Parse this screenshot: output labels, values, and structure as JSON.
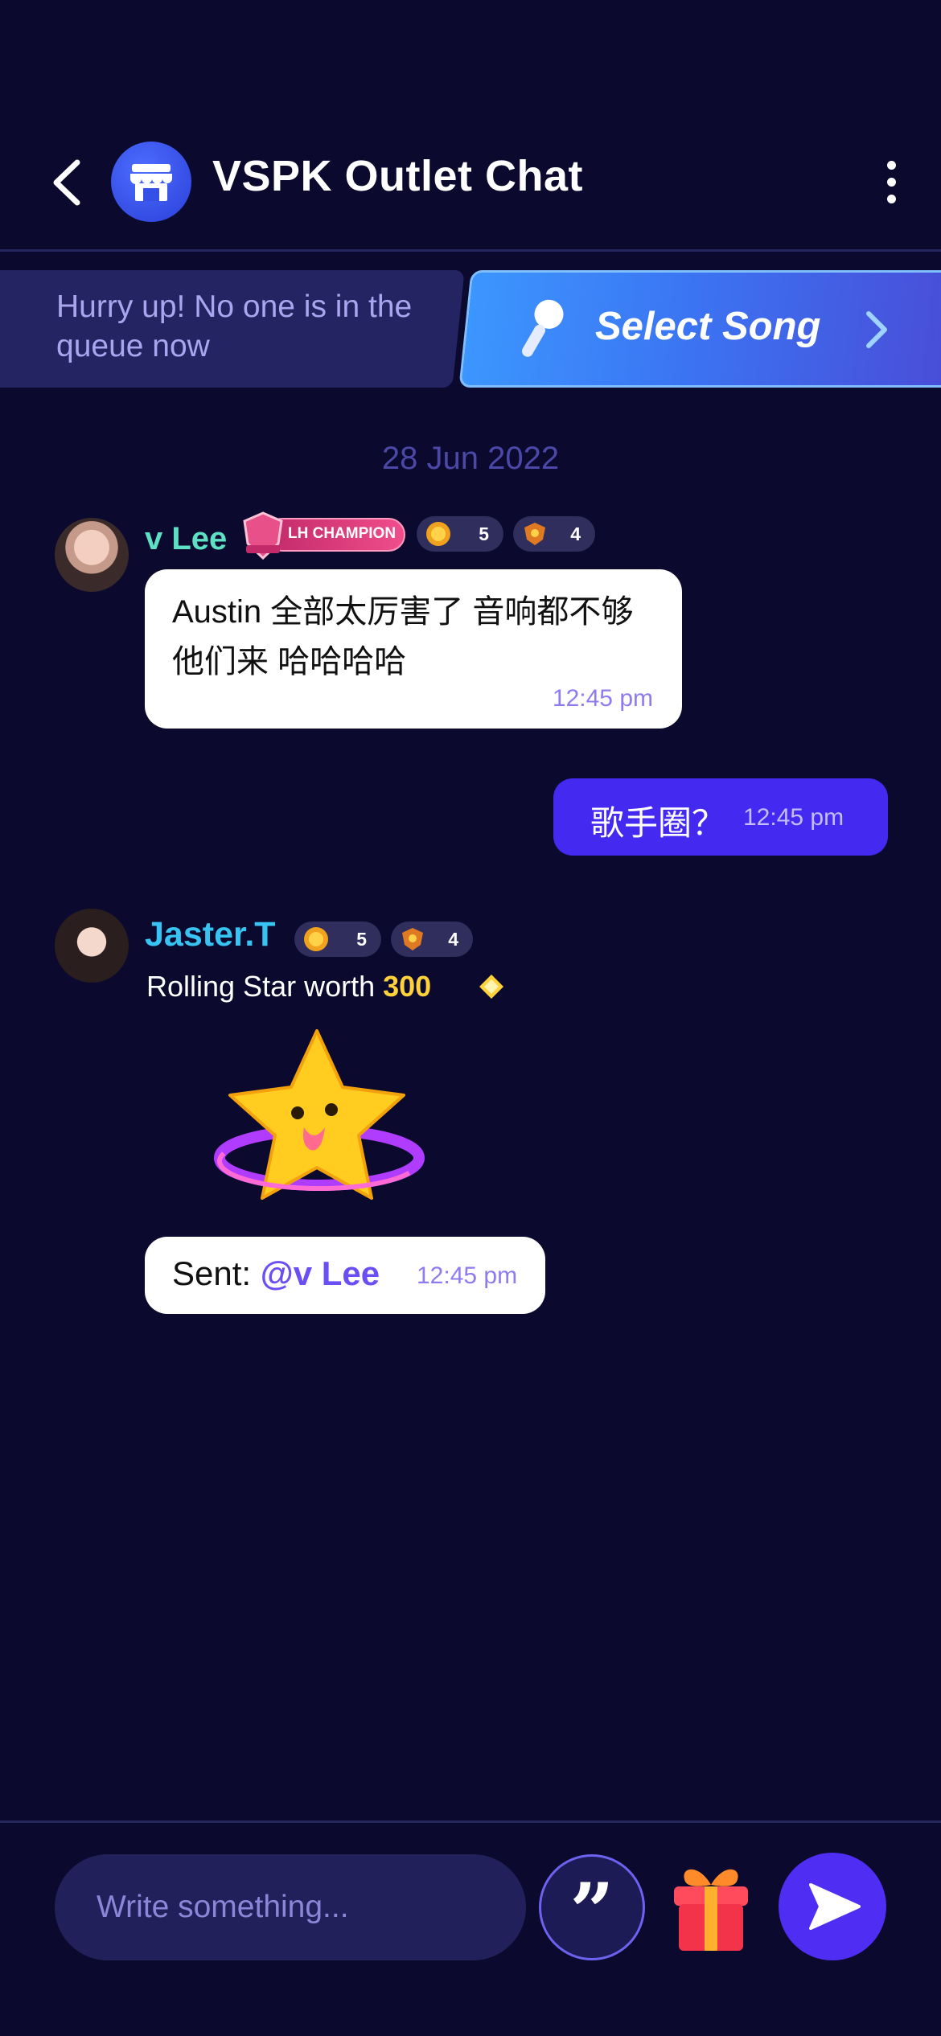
{
  "header": {
    "title": "VSPK Outlet Chat"
  },
  "queue": {
    "message": "Hurry up! No one is in the queue now",
    "select_song_label": "Select Song"
  },
  "date_separator": "28 Jun 2022",
  "messages": [
    {
      "user": "v Lee",
      "champion_badge": "LH CHAMPION",
      "badges": [
        "5",
        "4"
      ],
      "text": "Austin 全部太厉害了 音响都不够他们来 哈哈哈哈",
      "time": "12:45 pm"
    },
    {
      "self": true,
      "text": "歌手圈？",
      "time": "12:45 pm"
    },
    {
      "user": "Jaster.T",
      "badges": [
        "5",
        "4"
      ],
      "gift_prefix": "Rolling Star worth",
      "gift_amount": "300",
      "sent_prefix": "Sent:",
      "mention": "@v Lee",
      "time": "12:45 pm"
    }
  ],
  "composer": {
    "placeholder": "Write something...",
    "quote_glyph": "”"
  },
  "icons": {
    "back": "chevron-left-icon",
    "store": "store-icon",
    "more": "kebab-menu-icon",
    "mic": "microphone-icon",
    "forward": "chevron-right-icon",
    "gift": "gift-icon",
    "send": "send-icon",
    "diamond": "diamond-icon",
    "star_gift": "rolling-star-gift"
  },
  "colors": {
    "background": "#0b0a2e",
    "accent": "#4429f0",
    "username_1": "#5de0c3",
    "username_2": "#37c4f2",
    "gold": "#ffd13b"
  }
}
